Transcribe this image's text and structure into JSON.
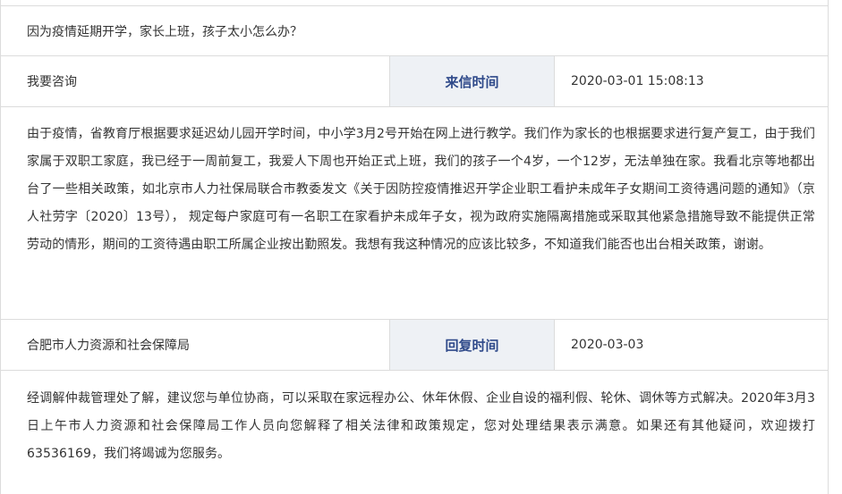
{
  "question_title": "因为疫情延期开学，家长上班，孩子太小怎么办？",
  "letter": {
    "type_label": "我要咨询",
    "time_label": "来信时间",
    "time_value": "2020-03-01 15:08:13",
    "content": "由于疫情，省教育厅根据要求延迟幼儿园开学时间，中小学3月2号开始在网上进行教学。我们作为家长的也根据要求进行复产复工，由于我们家属于双职工家庭，我已经于一周前复工，我爱人下周也开始正式上班，我们的孩子一个4岁，一个12岁，无法单独在家。我看北京等地都出台了一些相关政策，如北京市人力社保局联合市教委发文《关于因防控疫情推迟开学企业职工看护未成年子女期间工资待遇问题的通知》（京人社劳字〔2020〕13号），  规定每户家庭可有一名职工在家看护未成年子女，视为政府实施隔离措施或采取其他紧急措施导致不能提供正常劳动的情形，期间的工资待遇由职工所属企业按出勤照发。我想有我这种情况的应该比较多，不知道我们能否也出台相关政策，谢谢。"
  },
  "reply": {
    "org": "合肥市人力资源和社会保障局",
    "time_label": "回复时间",
    "time_value": "2020-03-03",
    "content": "经调解仲裁管理处了解，建议您与单位协商，可以采取在家远程办公、休年休假、企业自设的福利假、轮休、调休等方式解决。2020年3月3日上午市人力资源和社会保障局工作人员向您解释了相关法律和政策规定，您对处理结果表示满意。如果还有其他疑问，欢迎拨打63536169，我们将竭诚为您服务。"
  },
  "colors": {
    "border": "#dcdcdc",
    "label_bg": "#eef1f5",
    "label_text": "#2f4a8a",
    "text": "#333333"
  }
}
